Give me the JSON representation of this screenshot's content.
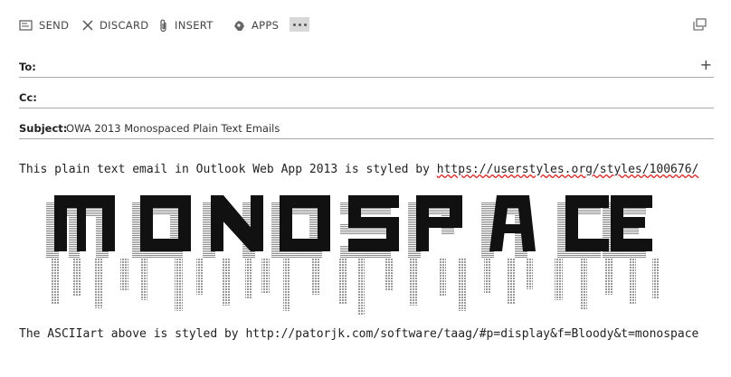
{
  "toolbar": {
    "send_label": "SEND",
    "discard_label": "DISCARD",
    "insert_label": "INSERT",
    "apps_label": "APPS",
    "more_icon": "ellipsis-icon",
    "popout_icon": "popout-icon"
  },
  "compose": {
    "to_label": "To:",
    "to_value": "",
    "cc_label": "Cc:",
    "cc_value": "",
    "subject_label": "Subject:",
    "subject_value": "OWA 2013 Monospaced Plain Text Emails",
    "add_recipient": "+"
  },
  "body": {
    "line1_text": "This plain text email in Outlook Web App 2013 is styled by ",
    "line1_link": "https://userstyles.org/styles/100676/",
    "ascii_word": "MONOSPACE",
    "line2_text": "The ASCIIart above is styled by http://patorjk.com/software/taag/#p=display&f=Bloody&t=monospace"
  },
  "colors": {
    "background": "#ffffff",
    "text": "#333333",
    "divider": "#a8a8a8",
    "spellcheck": "#dd2222"
  }
}
